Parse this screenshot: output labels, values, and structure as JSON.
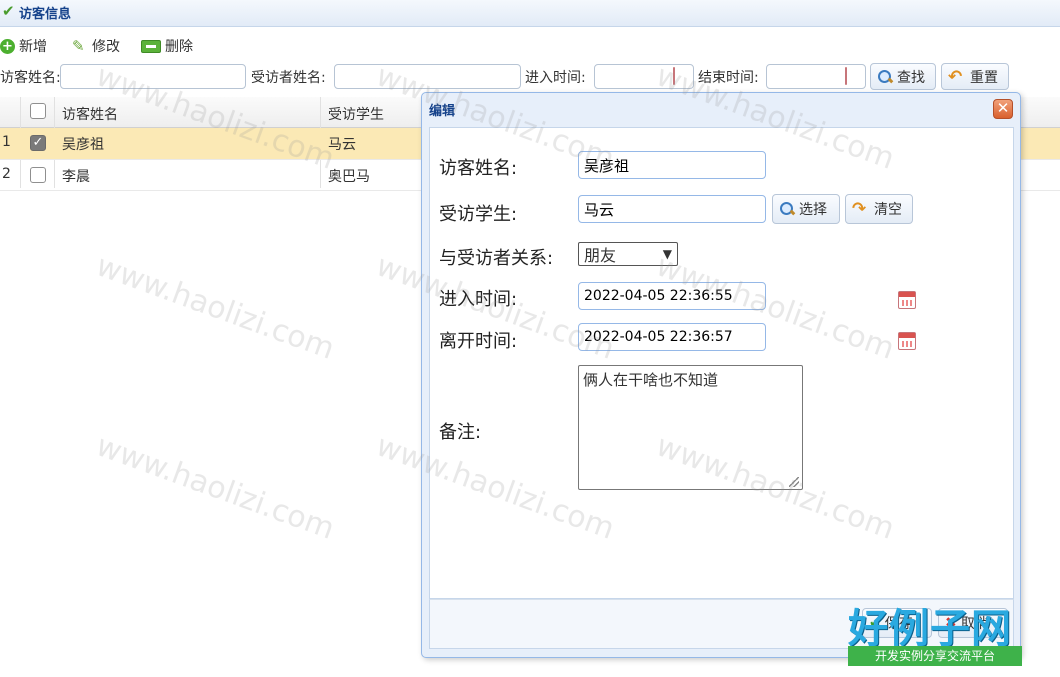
{
  "panel": {
    "title": "访客信息"
  },
  "toolbar": {
    "add_label": "新增",
    "edit_label": "修改",
    "delete_label": "删除"
  },
  "search": {
    "visitor_label": "访客姓名:",
    "visitee_label": "受访者姓名:",
    "enter_label": "进入时间:",
    "end_label": "结束时间:",
    "search_btn": "查找",
    "reset_btn": "重置"
  },
  "grid": {
    "headers": [
      "访客姓名",
      "受访学生"
    ],
    "rows": [
      {
        "num": "1",
        "checked": true,
        "visitor": "吴彦祖",
        "student": "马云"
      },
      {
        "num": "2",
        "checked": false,
        "visitor": "李晨",
        "student": "奥巴马"
      }
    ]
  },
  "dialog": {
    "title": "编辑",
    "visitor_label": "访客姓名:",
    "visitor_value": "吴彦祖",
    "student_label": "受访学生:",
    "student_value": "马云",
    "select_btn": "选择",
    "clear_btn": "清空",
    "relation_label": "与受访者关系:",
    "relation_value": "朋友",
    "enter_label": "进入时间:",
    "enter_value": "2022-04-05 22:36:55",
    "leave_label": "离开时间:",
    "leave_value": "2022-04-05 22:36:57",
    "remark_label": "备注:",
    "remark_value": "俩人在干啥也不知道",
    "save_btn": "保存",
    "cancel_btn": "取消"
  },
  "watermark": {
    "text": "www.haolizi.com",
    "logo_main": "好例子网",
    "logo_sub": "开发实例分享交流平台"
  },
  "colors": {
    "accent": "#15428b",
    "selected_row": "#fbe9b5",
    "border": "#95b8e7"
  }
}
